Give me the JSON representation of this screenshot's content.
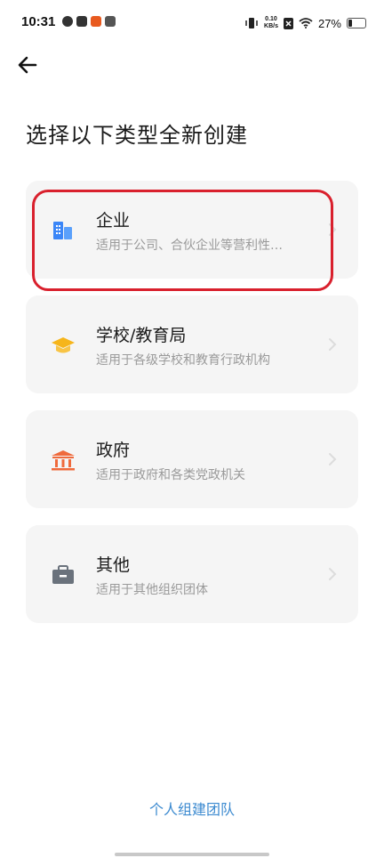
{
  "status_bar": {
    "time": "10:31",
    "net_speed_value": "0.10",
    "net_speed_unit": "KB/s",
    "battery_percent": "27%",
    "battery_level": 0.27
  },
  "header": {
    "back_icon": "arrow-left-icon",
    "title": "选择以下类型全新创建"
  },
  "options": [
    {
      "title": "企业",
      "subtitle": "适用于公司、合伙企业等营利性…",
      "icon": "building-icon",
      "icon_color": "#3b86f7",
      "selected": true
    },
    {
      "title": "学校/教育局",
      "subtitle": "适用于各级学校和教育行政机构",
      "icon": "graduation-cap-icon",
      "icon_color": "#f6b51a"
    },
    {
      "title": "政府",
      "subtitle": "适用于政府和各类党政机关",
      "icon": "government-building-icon",
      "icon_color": "#ef6a3c"
    },
    {
      "title": "其他",
      "subtitle": "适用于其他组织团体",
      "icon": "briefcase-icon",
      "icon_color": "#6a727c"
    }
  ],
  "footer": {
    "link_text": "个人组建团队",
    "link_color": "#3c8ad0"
  },
  "highlight_color": "#d9202d"
}
